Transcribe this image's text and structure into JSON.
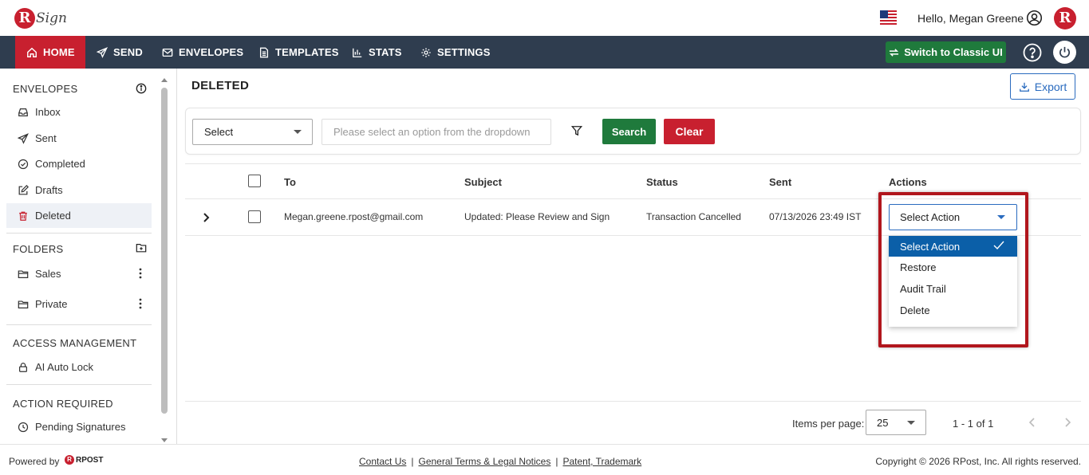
{
  "app": {
    "logo_text": "Sign",
    "logo_letter": "R",
    "brand_letter": "R"
  },
  "header": {
    "greeting": "Hello, Megan Greene"
  },
  "nav": {
    "items": [
      {
        "label": "HOME",
        "icon": "home-icon"
      },
      {
        "label": "SEND",
        "icon": "send-icon"
      },
      {
        "label": "ENVELOPES",
        "icon": "envelope-icon"
      },
      {
        "label": "TEMPLATES",
        "icon": "template-icon"
      },
      {
        "label": "STATS",
        "icon": "stats-icon"
      },
      {
        "label": "SETTINGS",
        "icon": "gear-icon"
      }
    ],
    "active": "HOME",
    "classic_label": "Switch to Classic UI"
  },
  "sidebar": {
    "envelopes_header": "ENVELOPES",
    "envelopes": [
      {
        "label": "Inbox",
        "icon": "inbox-icon"
      },
      {
        "label": "Sent",
        "icon": "send-icon"
      },
      {
        "label": "Completed",
        "icon": "check-circle-icon"
      },
      {
        "label": "Drafts",
        "icon": "edit-icon"
      },
      {
        "label": "Deleted",
        "icon": "trash-icon"
      }
    ],
    "folders_header": "FOLDERS",
    "folders": [
      {
        "label": "Sales",
        "icon": "folder-icon"
      },
      {
        "label": "Private",
        "icon": "folder-icon"
      }
    ],
    "access_header": "ACCESS MANAGEMENT",
    "access": [
      {
        "label": "AI Auto Lock",
        "icon": "lock-icon"
      }
    ],
    "action_header": "ACTION REQUIRED",
    "action": [
      {
        "label": "Pending Signatures",
        "icon": "clock-icon"
      }
    ]
  },
  "main": {
    "title": "DELETED",
    "export_label": "Export",
    "filter": {
      "select_value": "Select",
      "search_placeholder": "Please select an option from the dropdown",
      "search_label": "Search",
      "clear_label": "Clear"
    },
    "table": {
      "columns": [
        "To",
        "Subject",
        "Status",
        "Sent",
        "Actions"
      ],
      "rows": [
        {
          "to": "Megan.greene.rpost@gmail.com",
          "subject": "Updated: Please Review and Sign",
          "status": "Transaction Cancelled",
          "sent": "07/13/2026 23:49 IST",
          "action_value": "Select Action"
        }
      ]
    },
    "action_dropdown": {
      "options": [
        "Select Action",
        "Restore",
        "Audit Trail",
        "Delete"
      ],
      "selected": "Select Action"
    },
    "pagination": {
      "items_per_page_label": "Items per page:",
      "items_per_page": "25",
      "range": "1 - 1 of 1"
    }
  },
  "footer": {
    "powered_by": "Powered by",
    "rpost_text": "RPOST",
    "links": [
      "Contact Us",
      "General Terms & Legal Notices",
      "Patent, Trademark"
    ],
    "copyright": "Copyright © 2026 RPost, Inc. All rights reserved."
  },
  "colors": {
    "nav_bg": "#2f3d4f",
    "brand_red": "#c8202f",
    "green": "#1f7a3c",
    "blue": "#2a6bbf",
    "dropdown_selected": "#0b5fa8",
    "highlight": "#b1161d"
  }
}
